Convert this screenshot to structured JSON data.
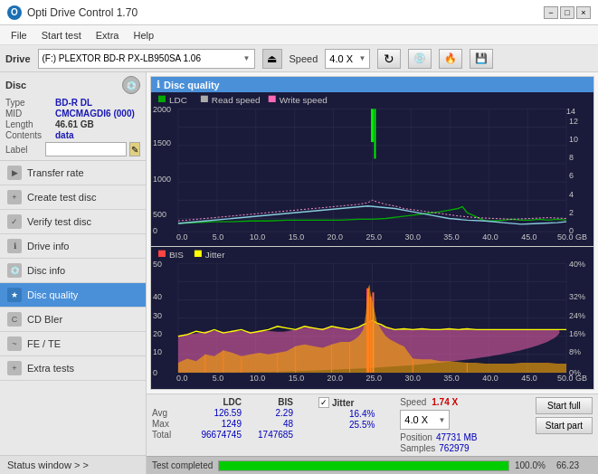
{
  "app": {
    "title": "Opti Drive Control 1.70",
    "icon": "O"
  },
  "titlebar": {
    "minimize": "−",
    "maximize": "□",
    "close": "×"
  },
  "menu": {
    "items": [
      "File",
      "Start test",
      "Extra",
      "Help"
    ]
  },
  "drivebar": {
    "drive_label": "Drive",
    "drive_value": "(F:)  PLEXTOR BD-R  PX-LB950SA 1.06",
    "speed_label": "Speed",
    "speed_value": "4.0 X"
  },
  "disc": {
    "title": "Disc",
    "type_label": "Type",
    "type_value": "BD-R DL",
    "mid_label": "MID",
    "mid_value": "CMCMAGDI6 (000)",
    "length_label": "Length",
    "length_value": "46.61 GB",
    "contents_label": "Contents",
    "contents_value": "data",
    "label_label": "Label",
    "label_placeholder": ""
  },
  "nav": {
    "items": [
      {
        "id": "transfer-rate",
        "label": "Transfer rate",
        "icon": "▶"
      },
      {
        "id": "create-test-disc",
        "label": "Create test disc",
        "icon": "◉"
      },
      {
        "id": "verify-test-disc",
        "label": "Verify test disc",
        "icon": "✓"
      },
      {
        "id": "drive-info",
        "label": "Drive info",
        "icon": "ℹ"
      },
      {
        "id": "disc-info",
        "label": "Disc info",
        "icon": "💿"
      },
      {
        "id": "disc-quality",
        "label": "Disc quality",
        "icon": "★",
        "active": true
      },
      {
        "id": "cd-bier",
        "label": "CD BIer",
        "icon": "🍺"
      },
      {
        "id": "fe-te",
        "label": "FE / TE",
        "icon": "~"
      },
      {
        "id": "extra-tests",
        "label": "Extra tests",
        "icon": "+"
      }
    ]
  },
  "status_window": {
    "label": "Status window > >"
  },
  "chart": {
    "title": "Disc quality",
    "top_legend": {
      "ldc": {
        "label": "LDC",
        "color": "#00aa00"
      },
      "read_speed": {
        "label": "Read speed",
        "color": "#aaaaaa"
      },
      "write_speed": {
        "label": "Write speed",
        "color": "#ff69b4"
      }
    },
    "bottom_legend": {
      "bis": {
        "label": "BIS",
        "color": "#ff0000"
      },
      "jitter": {
        "label": "Jitter",
        "color": "#ffff00"
      }
    },
    "top_y_left_max": 2000,
    "top_y_right_max": 18,
    "bottom_y_left_max": 50,
    "bottom_y_right_max": 40,
    "x_max": 50,
    "x_labels": [
      "0.0",
      "5.0",
      "10.0",
      "15.0",
      "20.0",
      "25.0",
      "30.0",
      "35.0",
      "40.0",
      "45.0",
      "50.0 GB"
    ]
  },
  "stats": {
    "ldc_header": "LDC",
    "bis_header": "BIS",
    "jitter_header": "Jitter",
    "speed_header": "Speed",
    "avg_label": "Avg",
    "max_label": "Max",
    "total_label": "Total",
    "ldc_avg": "126.59",
    "ldc_max": "1249",
    "ldc_total": "96674745",
    "bis_avg": "2.29",
    "bis_max": "48",
    "bis_total": "1747685",
    "jitter_avg": "16.4%",
    "jitter_max": "25.5%",
    "speed_value": "1.74 X",
    "speed_label": "Speed",
    "position_label": "Position",
    "position_value": "47731 MB",
    "samples_label": "Samples",
    "samples_value": "762979",
    "speed_select": "4.0 X"
  },
  "buttons": {
    "start_full": "Start full",
    "start_part": "Start part"
  },
  "progressbar": {
    "status": "Test completed",
    "percent": "100.0%",
    "value": 100,
    "right_value": "66.23"
  }
}
